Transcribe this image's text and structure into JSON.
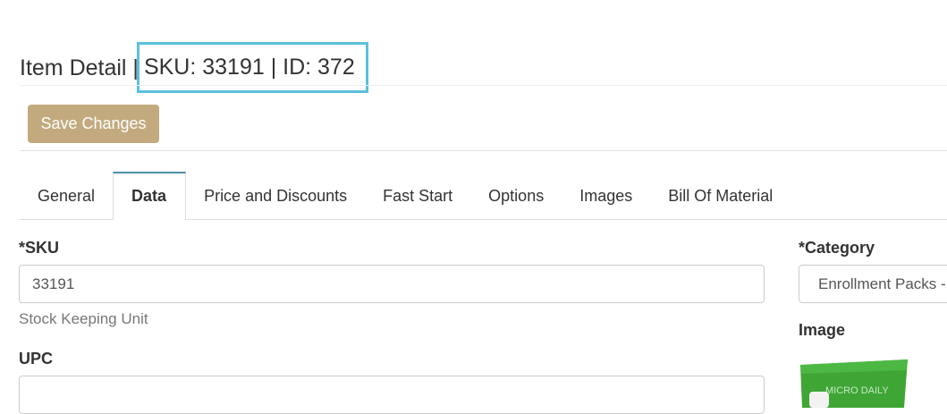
{
  "header": {
    "title_prefix": "Item Detail |",
    "title_highlight": "SKU: 33191 | ID: 372",
    "highlight_color": "#5bc0de"
  },
  "toolbar": {
    "save_label": "Save Changes",
    "save_color": "#c2aa7e"
  },
  "tabs": [
    {
      "label": "General",
      "active": false
    },
    {
      "label": "Data",
      "active": true
    },
    {
      "label": "Price and Discounts",
      "active": false
    },
    {
      "label": "Fast Start",
      "active": false
    },
    {
      "label": "Options",
      "active": false
    },
    {
      "label": "Images",
      "active": false
    },
    {
      "label": "Bill Of Material",
      "active": false
    }
  ],
  "form": {
    "sku": {
      "label": "*SKU",
      "value": "33191",
      "help": "Stock Keeping Unit"
    },
    "upc": {
      "label": "UPC",
      "value": ""
    },
    "category": {
      "label": "*Category",
      "value": "Enrollment Packs -"
    },
    "image": {
      "label": "Image",
      "thumb_text": "MICRO DAILY"
    }
  }
}
